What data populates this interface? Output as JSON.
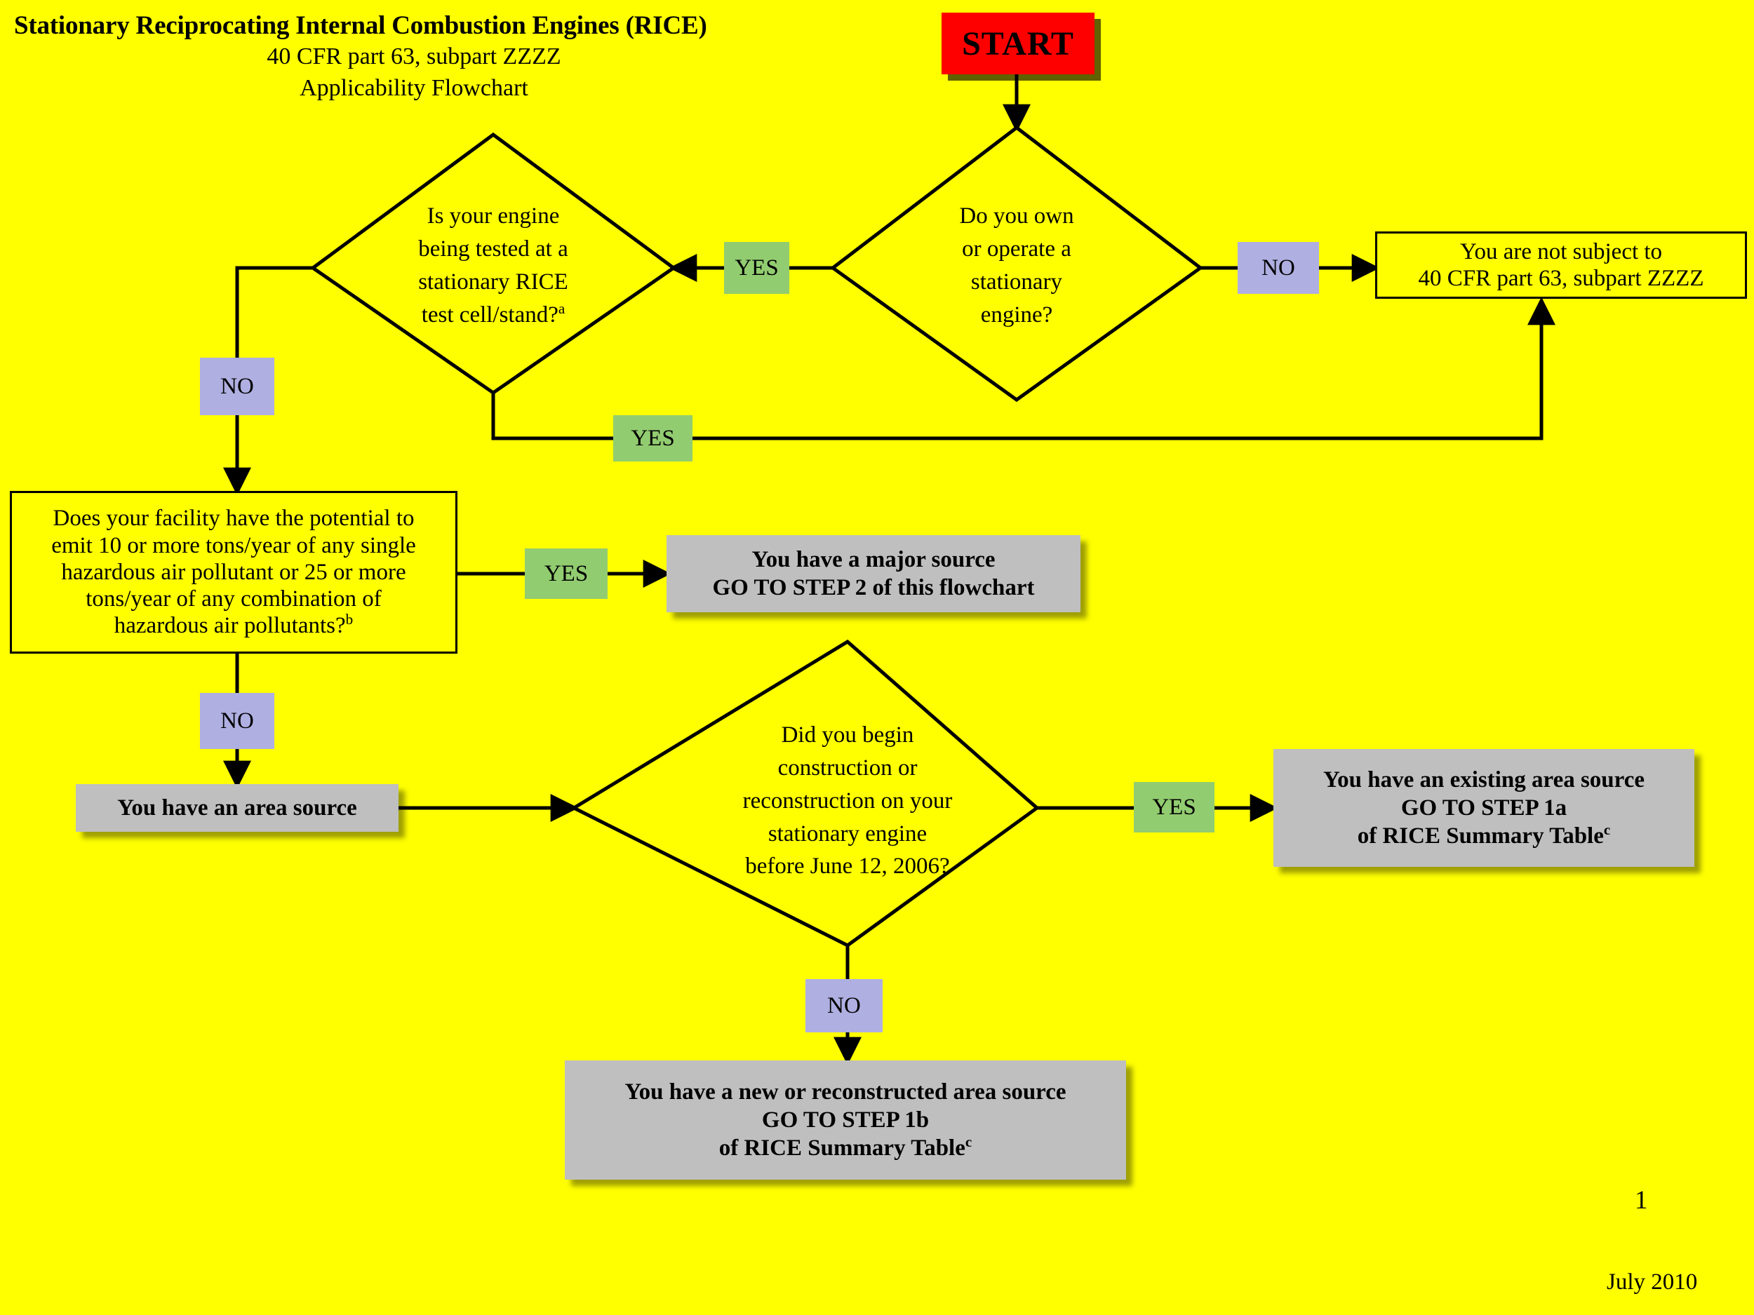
{
  "document": {
    "title_line1": "Stationary Reciprocating Internal Combustion Engines (RICE)",
    "title_line2": "40 CFR part 63, subpart ZZZZ",
    "title_line3": "Applicability Flowchart",
    "page_number": "1",
    "footer_date": "July 2010",
    "background_color": "#FFFF00"
  },
  "palette": {
    "background": "#FFFF00",
    "start_fill": "#FF0000",
    "yes_chip_fill": "#92CC70",
    "no_chip_fill": "#AFAFE2",
    "result_fill": "#BFBFBF",
    "line_color": "#000000"
  },
  "nodes": {
    "start": {
      "label": "START",
      "type": "terminator"
    },
    "own_operate": {
      "type": "decision",
      "lines": [
        "Do you own",
        "or operate a",
        "stationary",
        "engine?"
      ]
    },
    "test_cell": {
      "type": "decision",
      "lines": [
        "Is your engine",
        "being tested at a",
        "stationary RICE",
        "test cell/stand?"
      ],
      "superscript": "a"
    },
    "not_subject": {
      "type": "process",
      "lines": [
        "You are not subject to",
        "40 CFR part 63, subpart ZZZZ"
      ]
    },
    "facility_potential": {
      "type": "process",
      "lines": [
        "Does your facility have the potential to",
        "emit 10 or more tons/year of any single",
        "hazardous air pollutant or 25 or more",
        "tons/year of any combination of",
        "hazardous air pollutants?"
      ],
      "superscript": "b"
    },
    "major_source": {
      "type": "result",
      "lines": [
        "You have a major source",
        "GO TO STEP 2 of this flowchart"
      ]
    },
    "area_source": {
      "type": "result",
      "lines": [
        "You have an area source"
      ]
    },
    "construction_date": {
      "type": "decision",
      "lines": [
        "Did you begin",
        "construction or",
        "reconstruction on your",
        "stationary engine",
        "before June 12, 2006?"
      ]
    },
    "existing_area_source": {
      "type": "result",
      "lines": [
        "You have an existing area source",
        "GO TO STEP 1a",
        "of  RICE Summary Table"
      ],
      "superscript": "c"
    },
    "new_area_source": {
      "type": "result",
      "lines": [
        "You have a new or reconstructed area source",
        "GO TO STEP 1b",
        "of  RICE Summary Table"
      ],
      "superscript": "c"
    }
  },
  "connectors": [
    {
      "id": "own-operate-no",
      "label": "NO",
      "from": "own_operate",
      "to": "not_subject"
    },
    {
      "id": "own-operate-yes",
      "label": "YES",
      "from": "own_operate",
      "to": "test_cell"
    },
    {
      "id": "test-cell-yes",
      "label": "YES",
      "from": "test_cell",
      "to": "not_subject"
    },
    {
      "id": "test-cell-no",
      "label": "NO",
      "from": "test_cell",
      "to": "facility_potential"
    },
    {
      "id": "facility-yes",
      "label": "YES",
      "from": "facility_potential",
      "to": "major_source"
    },
    {
      "id": "facility-no",
      "label": "NO",
      "from": "facility_potential",
      "to": "area_source"
    },
    {
      "id": "construction-yes",
      "label": "YES",
      "from": "construction_date",
      "to": "existing_area_source"
    },
    {
      "id": "construction-no",
      "label": "NO",
      "from": "construction_date",
      "to": "new_area_source"
    }
  ]
}
